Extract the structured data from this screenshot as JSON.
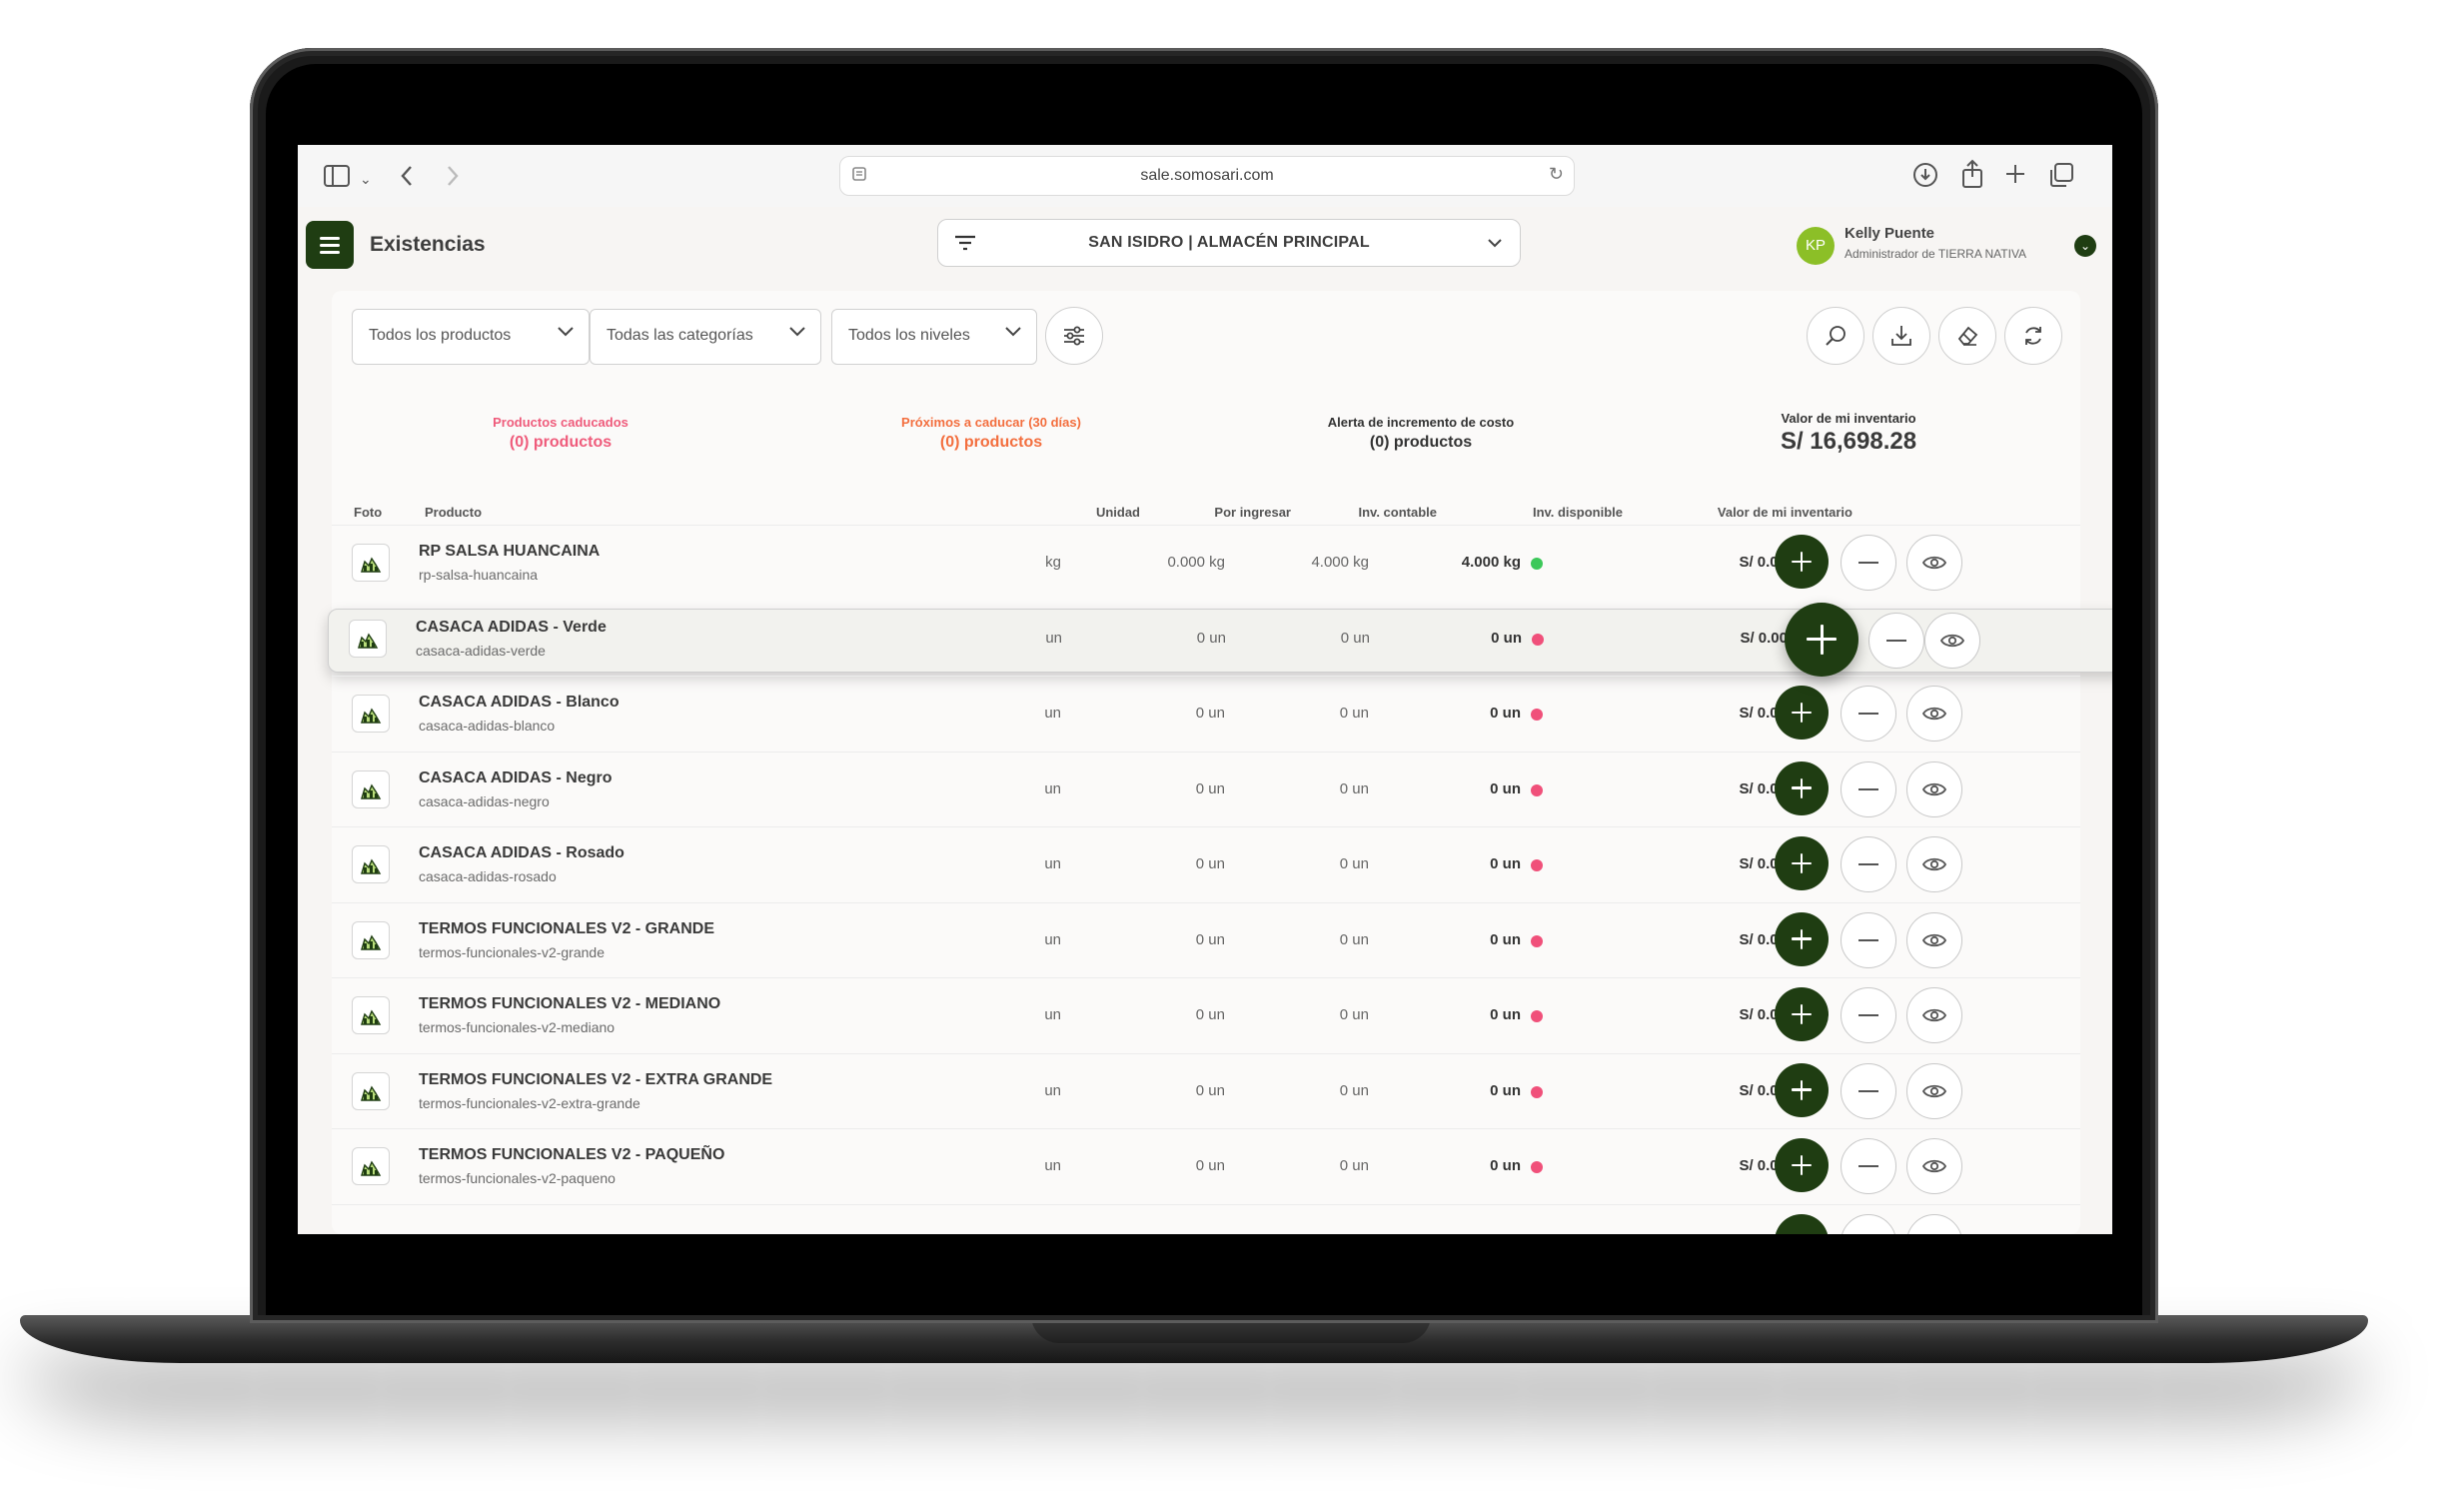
{
  "browser": {
    "url": "sale.somosari.com"
  },
  "header": {
    "title": "Existencias",
    "store": "SAN ISIDRO | ALMACÉN PRINCIPAL",
    "user": {
      "initials": "KP",
      "name": "Kelly Puente",
      "role": "Administrador de TIERRA NATIVA"
    }
  },
  "filters": {
    "products": "Todos los productos",
    "categories": "Todas las categorías",
    "levels": "Todos los niveles"
  },
  "summary": {
    "expired_label": "Productos caducados",
    "expired_value": "(0) productos",
    "expiring_label": "Próximos a caducar (30 días)",
    "expiring_value": "(0) productos",
    "cost_alert_label": "Alerta de incremento de costo",
    "cost_alert_value": "(0) productos",
    "inventory_label": "Valor de mi inventario",
    "inventory_value": "S/ 16,698.28"
  },
  "table": {
    "columns": {
      "photo": "Foto",
      "product": "Producto",
      "unit": "Unidad",
      "incoming": "Por ingresar",
      "accounting": "Inv. contable",
      "available": "Inv. disponible",
      "value": "Valor de mi inventario"
    },
    "rows": [
      {
        "name": "RP SALSA HUANCAINA",
        "slug": "rp-salsa-huancaina",
        "unit": "kg",
        "incoming": "0.000 kg",
        "accounting": "4.000 kg",
        "available": "4.000 kg",
        "status": "ok",
        "value": "S/ 0.00"
      },
      {
        "name": "CASACA ADIDAS - Verde",
        "slug": "casaca-adidas-verde",
        "unit": "un",
        "incoming": "0 un",
        "accounting": "0 un",
        "available": "0 un",
        "status": "empty",
        "value": "S/ 0.00",
        "highlighted": true
      },
      {
        "name": "CASACA ADIDAS - Blanco",
        "slug": "casaca-adidas-blanco",
        "unit": "un",
        "incoming": "0 un",
        "accounting": "0 un",
        "available": "0 un",
        "status": "empty",
        "value": "S/ 0.00"
      },
      {
        "name": "CASACA ADIDAS - Negro",
        "slug": "casaca-adidas-negro",
        "unit": "un",
        "incoming": "0 un",
        "accounting": "0 un",
        "available": "0 un",
        "status": "empty",
        "value": "S/ 0.00"
      },
      {
        "name": "CASACA ADIDAS - Rosado",
        "slug": "casaca-adidas-rosado",
        "unit": "un",
        "incoming": "0 un",
        "accounting": "0 un",
        "available": "0 un",
        "status": "empty",
        "value": "S/ 0.00"
      },
      {
        "name": "TERMOS FUNCIONALES V2 - GRANDE",
        "slug": "termos-funcionales-v2-grande",
        "unit": "un",
        "incoming": "0 un",
        "accounting": "0 un",
        "available": "0 un",
        "status": "empty",
        "value": "S/ 0.00"
      },
      {
        "name": "TERMOS FUNCIONALES V2 - MEDIANO",
        "slug": "termos-funcionales-v2-mediano",
        "unit": "un",
        "incoming": "0 un",
        "accounting": "0 un",
        "available": "0 un",
        "status": "empty",
        "value": "S/ 0.00"
      },
      {
        "name": "TERMOS FUNCIONALES V2 - EXTRA GRANDE",
        "slug": "termos-funcionales-v2-extra-grande",
        "unit": "un",
        "incoming": "0 un",
        "accounting": "0 un",
        "available": "0 un",
        "status": "empty",
        "value": "S/ 0.00"
      },
      {
        "name": "TERMOS FUNCIONALES V2 - PAQUEÑO",
        "slug": "termos-funcionales-v2-paqueno",
        "unit": "un",
        "incoming": "0 un",
        "accounting": "0 un",
        "available": "0 un",
        "status": "empty",
        "value": "S/ 0.00"
      }
    ]
  },
  "colors": {
    "brand": "#1f3d12",
    "expired": "#ef5b7b",
    "expiring": "#f36f3f",
    "ok": "#3cc85a",
    "empty": "#f0507a",
    "avatar": "#8cbf27"
  },
  "icons": [
    "sidebar-icon",
    "chevron-left-icon",
    "chevron-right-icon",
    "download-icon",
    "share-icon",
    "plus-icon",
    "tabs-icon",
    "filter-icon",
    "sliders-icon",
    "search-icon",
    "eraser-icon",
    "refresh-icon",
    "eye-icon",
    "product-icon"
  ]
}
